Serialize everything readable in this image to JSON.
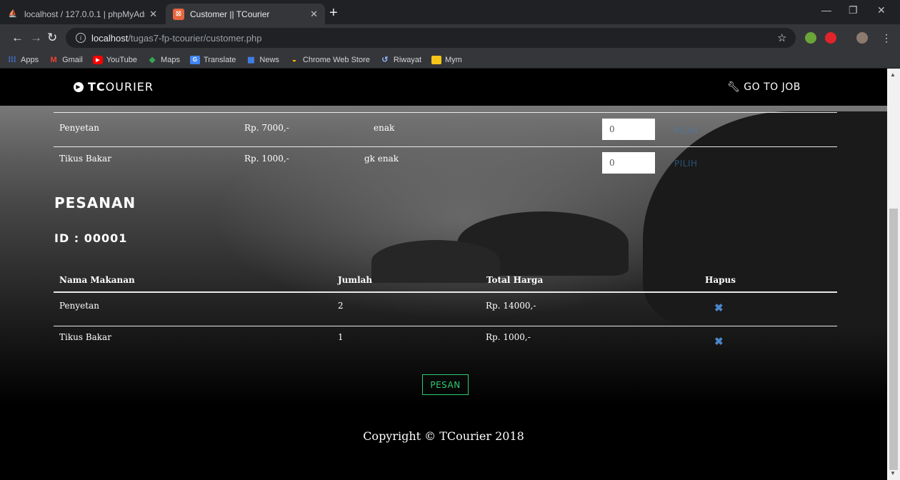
{
  "browser": {
    "tabs": [
      {
        "title": "localhost / 127.0.0.1 | phpMyAdm",
        "active": false
      },
      {
        "title": "Customer || TCourier",
        "active": true
      }
    ],
    "url_host": "localhost",
    "url_path": "/tugas7-fp-tcourier/customer.php",
    "bookmarks": [
      "Apps",
      "Gmail",
      "YouTube",
      "Maps",
      "Translate",
      "News",
      "Chrome Web Store",
      "Riwayat",
      "Mym"
    ]
  },
  "navbar": {
    "brand_bold": "TC",
    "brand_rest": "OURIER",
    "link": "GO TO JOB"
  },
  "menu": {
    "rows": [
      {
        "name": "Penyetan",
        "price": "Rp. 7000,-",
        "desc": "enak",
        "qty": "0",
        "action": "PILIH"
      },
      {
        "name": "Tikus Bakar",
        "price": "Rp. 1000,-",
        "desc": "gk enak",
        "qty": "0",
        "action": "PILIH"
      }
    ]
  },
  "order": {
    "heading": "PESANAN",
    "id_label": "ID : 00001",
    "headers": {
      "name": "Nama Makanan",
      "qty": "Jumlah",
      "total": "Total Harga",
      "delete": "Hapus"
    },
    "rows": [
      {
        "name": "Penyetan",
        "qty": "2",
        "total": "Rp. 14000,-"
      },
      {
        "name": "Tikus Bakar",
        "qty": "1",
        "total": "Rp. 1000,-"
      }
    ],
    "submit_label": "PESAN"
  },
  "footer": {
    "copyright": "Copyright © TCourier 2018"
  },
  "colors": {
    "accent_green": "#2ecc71",
    "link_blue": "#3a7fc0"
  }
}
